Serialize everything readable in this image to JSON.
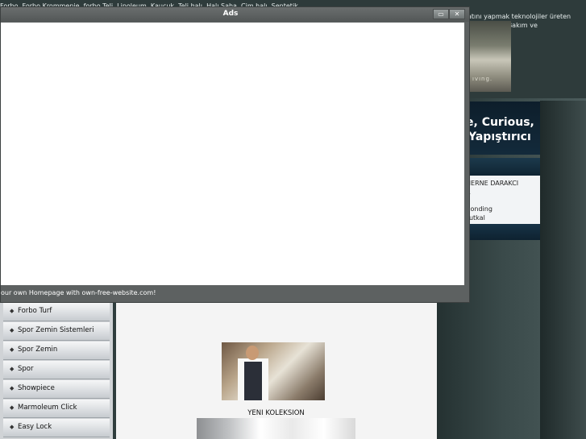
{
  "top_text": {
    "line1": "Forbo, Forbo Krommenie, forbo Teli, Linoleum, Kauçuk, Teli halı, Halı Saha, Çim halı, Sentetik",
    "line2": "atını yapmak teknolojiler üreten",
    "line3": "el Bakım ve"
  },
  "thumb": {
    "caption": "ıvıng."
  },
  "banner": {
    "line1": "e, Curious,",
    "line2": "Yapıştırıcı"
  },
  "side_box": {
    "line1": "HERNE DARAKCI",
    "line2": "A",
    "line3": "Bonding",
    "line4": "Yutkal"
  },
  "ads_popup": {
    "title": "Ads",
    "maximize_symbol": "▭",
    "close_symbol": "✕",
    "footer": "our own Homepage with own-free-website.com!"
  },
  "menu": {
    "bullet": "◆",
    "items": [
      "Forbo Turf",
      "Spor Zemin Sistemleri",
      "Spor Zemin",
      "Spor",
      "Showpiece",
      "Marmoleum Click",
      "Easy Lock"
    ]
  },
  "content": {
    "caption": "YENI KOLEKSION"
  }
}
